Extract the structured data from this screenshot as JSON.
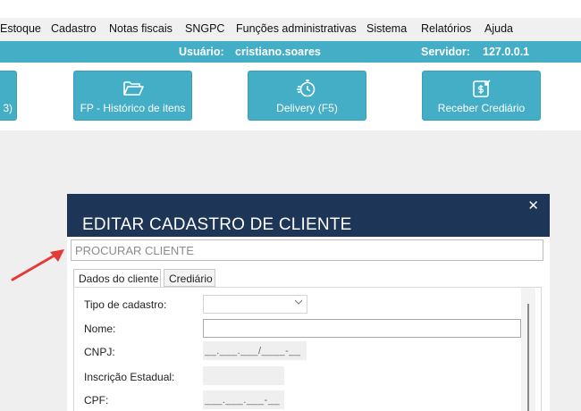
{
  "menu": {
    "items": [
      "Estoque",
      "Cadastro",
      "Notas fiscais",
      "SNGPC",
      "Funções administrativas",
      "Sistema",
      "Relatórios",
      "Ajuda"
    ]
  },
  "status": {
    "user_label": "Usuário:",
    "user_value": "cristiano.soares",
    "server_label": "Servidor:",
    "server_value": "127.0.0.1"
  },
  "toolbar": {
    "btn_partial": "3)",
    "btn_historico": "FP - Histórico de itens",
    "btn_delivery": "Delivery (F5)",
    "btn_crediario": "Receber Crediário"
  },
  "dialog": {
    "title": "EDITAR CADASTRO DE CLIENTE",
    "close": "✕",
    "search_placeholder": "PROCURAR CLIENTE",
    "tabs": [
      "Dados do cliente",
      "Crediário"
    ],
    "fields": {
      "tipo_label": "Tipo de cadastro:",
      "nome_label": "Nome:",
      "cnpj_label": "CNPJ:",
      "cnpj_mask": "__.___.___/____-__",
      "ie_label": "Inscrição Estadual:",
      "cpf_label": "CPF:",
      "cpf_mask": "___.___.___-__"
    }
  },
  "colors": {
    "accent": "#43aec6",
    "dialog_header": "#1d3557",
    "annotation_arrow": "#e53935"
  }
}
